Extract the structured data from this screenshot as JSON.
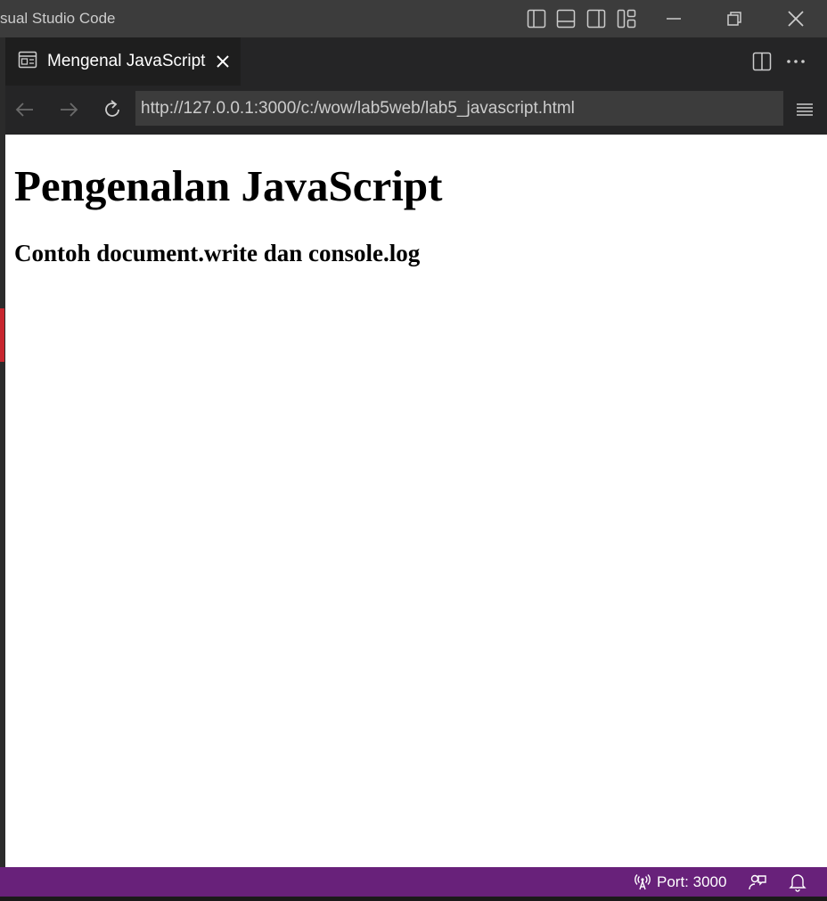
{
  "window": {
    "title": "sual Studio Code",
    "layout_icons": [
      "toggle-primary-sidebar-icon",
      "toggle-panel-icon",
      "toggle-secondary-sidebar-icon",
      "customize-layout-icon"
    ],
    "controls": [
      "minimize-icon",
      "restore-icon",
      "close-icon"
    ]
  },
  "tab": {
    "label": "Mengenal JavaScript",
    "icon": "preview-icon",
    "actions": [
      "split-editor-icon",
      "more-actions-icon"
    ]
  },
  "nav": {
    "url": "http://127.0.0.1:3000/c:/wow/lab5web/lab5_javascript.html",
    "buttons": [
      "back-icon",
      "forward-icon",
      "reload-icon",
      "menu-icon"
    ]
  },
  "page": {
    "heading": "Pengenalan JavaScript",
    "subheading": "Contoh document.write dan console.log"
  },
  "statusbar": {
    "port_label": "Port: 3000",
    "color": "#68217a"
  },
  "colors": {
    "titlebar": "#3c3c3c",
    "tabbar": "#252526",
    "active_tab": "#1e1e1e",
    "url_field": "#3c3c3c"
  }
}
